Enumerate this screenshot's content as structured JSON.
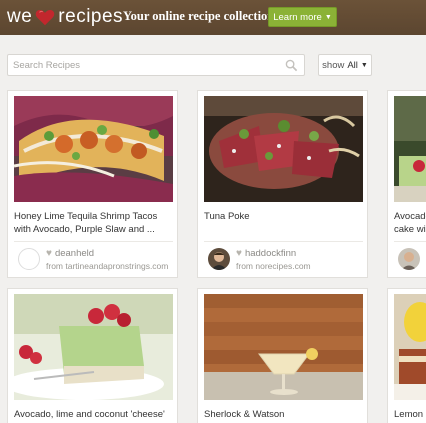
{
  "header": {
    "logo_prefix": "we",
    "logo_suffix": "recipes",
    "tagline": "Your online recipe collection",
    "learn_more": "Learn more",
    "brand_red": "#c2272d",
    "button_green": "#8bb236"
  },
  "toolbar": {
    "search_placeholder": "Search Recipes",
    "show_label": "show",
    "show_value": "All"
  },
  "recipes": [
    {
      "title_line1": "Honey Lime Tequila Shrimp Tacos",
      "title_line2": "with Avocado, Purple Slaw and ...",
      "user": "deanheld",
      "source": "from tartineandapronstrings.com"
    },
    {
      "title_line1": "Tuna Poke",
      "user": "haddockfinn",
      "source": "from norecipes.com"
    },
    {
      "title_line1": "Avocado",
      "title_line2": "cake wi"
    },
    {
      "title_line1": "Avocado, lime and coconut 'cheese'"
    },
    {
      "title_line1": "Sherlock & Watson"
    },
    {
      "title_line1": "Lemon"
    }
  ]
}
